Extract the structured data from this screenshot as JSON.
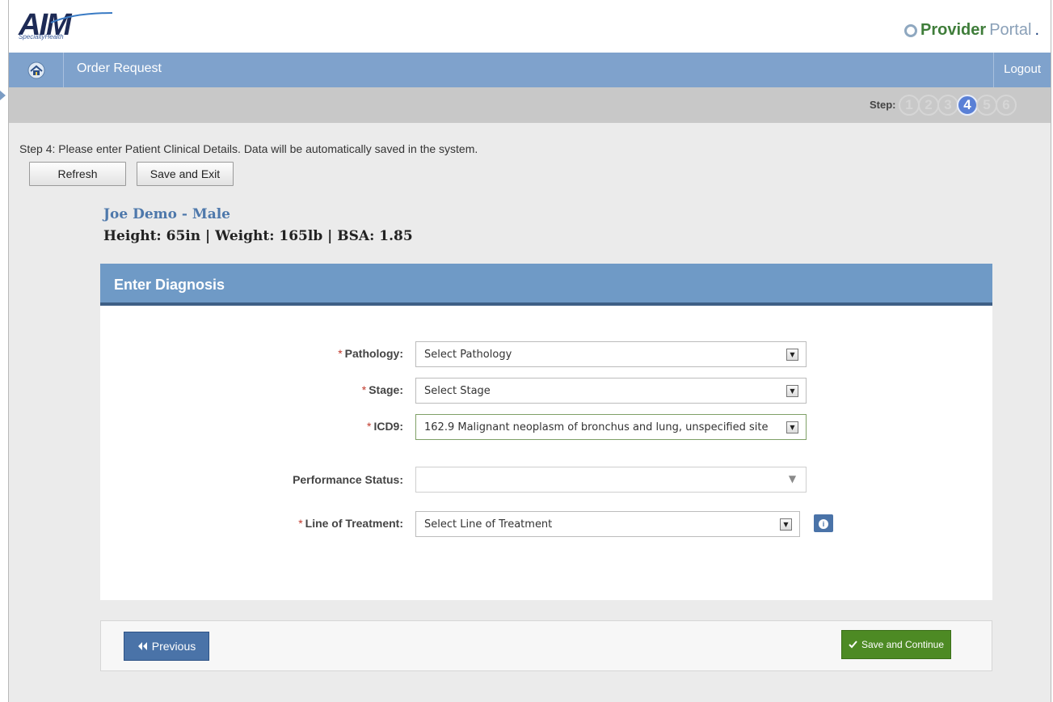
{
  "header": {
    "logo_text": "AIM",
    "logo_sub": "SpecialtyHealth",
    "portal_brand_part1": "Provider",
    "portal_brand_part2": "Portal",
    "portal_brand_dot": "."
  },
  "nav": {
    "title": "Order Request",
    "logout_label": "Logout"
  },
  "stepper": {
    "label": "Step:",
    "steps": [
      "1",
      "2",
      "3",
      "4",
      "5",
      "6"
    ],
    "active_step": "4"
  },
  "content": {
    "instruction": "Step 4:  Please enter Patient Clinical Details.  Data will be automatically saved in the system.",
    "refresh_label": "Refresh",
    "save_exit_label": "Save and Exit"
  },
  "patient": {
    "name_line": "Joe Demo  - Male",
    "metrics_line": "Height: 65in  |  Weight:  165lb  |  BSA: 1.85"
  },
  "diagnosis": {
    "title": "Enter Diagnosis",
    "required_marker": "*",
    "pathology_label": "Pathology:",
    "pathology_value": "Select Pathology",
    "stage_label": "Stage:",
    "stage_value": "Select Stage",
    "icd9_label": "ICD9:",
    "icd9_value": "162.9 Malignant neoplasm of bronchus and lung, unspecified site",
    "performance_label": "Performance Status:",
    "performance_value": "",
    "line_label": "Line of Treatment:",
    "line_value": "Select Line of Treatment"
  },
  "footer": {
    "previous_label": "Previous",
    "save_continue_label": "Save and Continue"
  },
  "colors": {
    "nav_bg": "#7fa2cc",
    "panel_head_bg": "#6f9ac6",
    "primary_button": "#4a73a8",
    "success_button": "#4d8a24",
    "active_step": "#5a80d6"
  },
  "icons": {
    "home": "home-icon",
    "info": "info-icon",
    "previous": "double-chevron-left-icon",
    "save": "checkmark-icon"
  }
}
